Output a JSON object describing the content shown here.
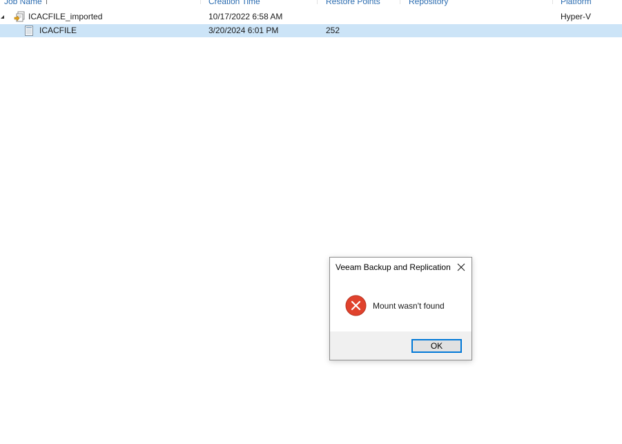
{
  "table": {
    "columns": {
      "job_name": "Job Name",
      "creation_time": "Creation Time",
      "restore_points": "Restore Points",
      "repository": "Repository",
      "platform": "Platform"
    },
    "rows": [
      {
        "name": "ICACFILE_imported",
        "creation_time": "10/17/2022 6:58 AM",
        "restore_points": "",
        "repository": "",
        "platform": "Hyper-V",
        "expanded": true,
        "selected": false
      },
      {
        "name": "ICACFILE",
        "creation_time": "3/20/2024 6:01 PM",
        "restore_points": "252",
        "repository": "",
        "platform": "",
        "selected": true
      }
    ]
  },
  "dialog": {
    "title": "Veeam Backup and Replication",
    "message": "Mount wasn't found",
    "ok_label": "OK",
    "icon": "error-icon"
  },
  "colors": {
    "header_text": "#2b6cb0",
    "selection": "#cce4f7",
    "error_red": "#e0422d",
    "button_focus": "#0078d7"
  }
}
